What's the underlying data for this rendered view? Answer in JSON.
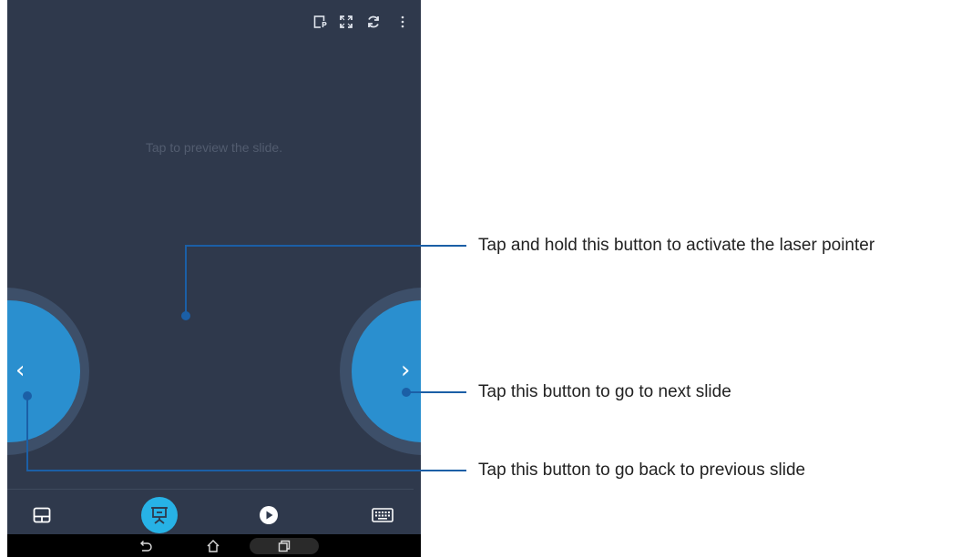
{
  "screen": {
    "preview_hint": "Tap to preview the slide."
  },
  "toolbar": {
    "icons": [
      "presenter-notes-icon",
      "fullscreen-icon",
      "refresh-icon",
      "more-vertical-icon"
    ]
  },
  "controls": {
    "prev_glyph": "‹",
    "next_glyph": "›"
  },
  "bottom_tools": [
    "touchpad-icon",
    "presentation-icon",
    "play-icon",
    "keyboard-icon"
  ],
  "navigation": [
    "back-icon",
    "home-icon",
    "recent-apps-icon"
  ],
  "callouts": {
    "laser": "Tap and hold this button to activate the laser pointer",
    "next": "Tap this button to go to next slide",
    "previous": "Tap this button to go back to previous slide"
  },
  "colors": {
    "screen_bg": "#2f394c",
    "button_blue": "#2a8fcf",
    "active_tool": "#27b2e6",
    "leader_line": "#1b5fa6"
  }
}
